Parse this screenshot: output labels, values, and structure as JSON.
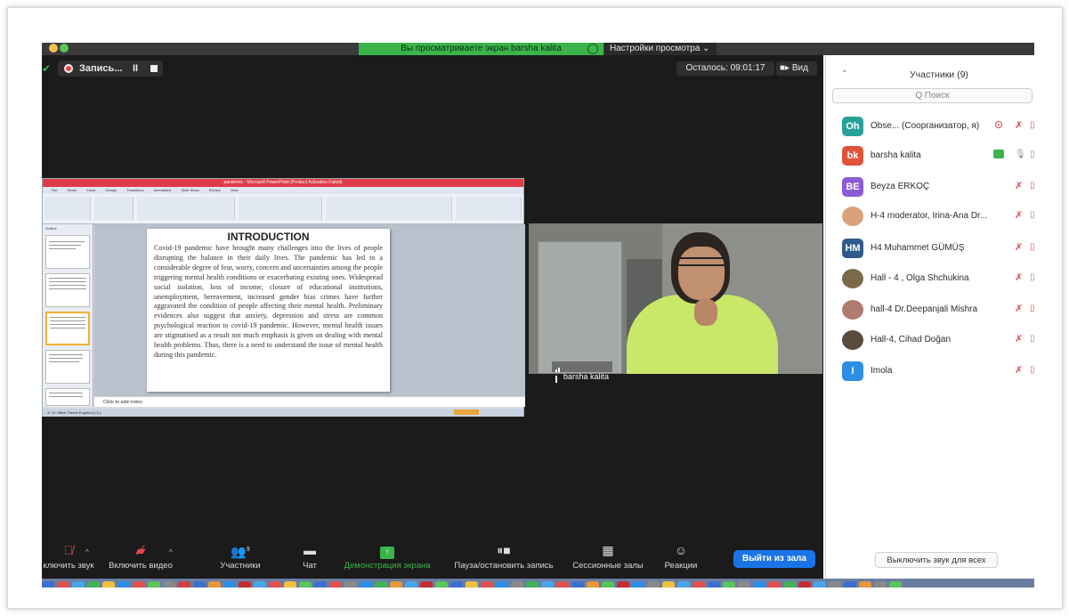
{
  "top_bar": {
    "share_banner": "Вы просматриваете экран barsha kalita",
    "view_settings": "Настройки просмотра ⌄"
  },
  "meeting": {
    "recording_label": "Запись...",
    "pause_glyph": "II",
    "time_left": "Осталось: 09:01:17",
    "view_label": "Вид"
  },
  "presentation": {
    "window_title": "pandemic - Microsoft PowerPoint (Product Activation Failed)",
    "tabs": [
      "File",
      "Home",
      "Insert",
      "Design",
      "Transitions",
      "Animations",
      "Slide Show",
      "Review",
      "View"
    ],
    "slide_title": "INTRODUCTION",
    "slide_body": "Covid-19 pandemic have brought many challenges into the lives of people disrupting the balance in their daily lives. The pandemic has led to a considerable degree of fear, worry, concern and uncertainties among the people triggering mental health conditions or exacerbating existing ones. Widespread social isolation, loss of income, closure of educational institutions, unemployment, bereavement, increased gender bias crimes have further aggravated the condition of people affecting their mental health. Preliminary evidences also suggest that anxiety, depression and stress are common psychological reaction to covid-19 pandemic. However, mental health issues are stigmatised as a result not much emphasis is given on dealing with mental health problems. Thus, there is a need to understand the issue of mental health during this pandemic.",
    "notes_placeholder": "Click to add notes",
    "outline_tab": "Outline",
    "status_text": "4 / 11   Office Theme   English (U.S.)"
  },
  "video": {
    "participant_name": "barsha kalita"
  },
  "toolbar": {
    "mute": "ключить звук",
    "video": "Включить видео",
    "participants": "Участники",
    "participants_count": "9",
    "chat": "Чат",
    "share_screen": "Демонстрация экрана",
    "pause_recording": "Пауза/остановить запись",
    "breakout": "Сессионные залы",
    "reactions": "Реакции",
    "leave": "Выйти из зала"
  },
  "panel": {
    "title": "Участники (9)",
    "search_placeholder": "Q Поиск",
    "mute_all": "Выключить звук для всех",
    "participants": [
      {
        "initials": "Oh",
        "name": "Obse... (Соорганизатор, я)",
        "color": "#2aa198"
      },
      {
        "initials": "bk",
        "name": "barsha kalita",
        "color": "#e0533a"
      },
      {
        "initials": "BE",
        "name": "Beyza ERKOÇ",
        "color": "#8c5bd6"
      },
      {
        "initials": "",
        "name": "H-4 moderator, Irina-Ana Dr...",
        "color": "#d9a27a"
      },
      {
        "initials": "HM",
        "name": "H4 Muhammet GÜMÜŞ",
        "color": "#2e5c8a"
      },
      {
        "initials": "",
        "name": "Hall - 4 ,  Olga Shchukina",
        "color": "#7b6a4a"
      },
      {
        "initials": "",
        "name": "hall-4 Dr.Deepanjali Mishra",
        "color": "#b07a70"
      },
      {
        "initials": "",
        "name": "Hall-4, Cihad Doğan",
        "color": "#5a4a3a"
      },
      {
        "initials": "I",
        "name": "Imola",
        "color": "#2d8ee6"
      }
    ]
  },
  "icons": {
    "mic_off": "mic-off-icon",
    "video_off": "video-off-icon",
    "participants": "participants-icon",
    "chat": "chat-icon",
    "share": "share-screen-icon",
    "pause": "pause-stop-icon",
    "breakout": "breakout-rooms-icon",
    "reactions": "reactions-icon"
  }
}
